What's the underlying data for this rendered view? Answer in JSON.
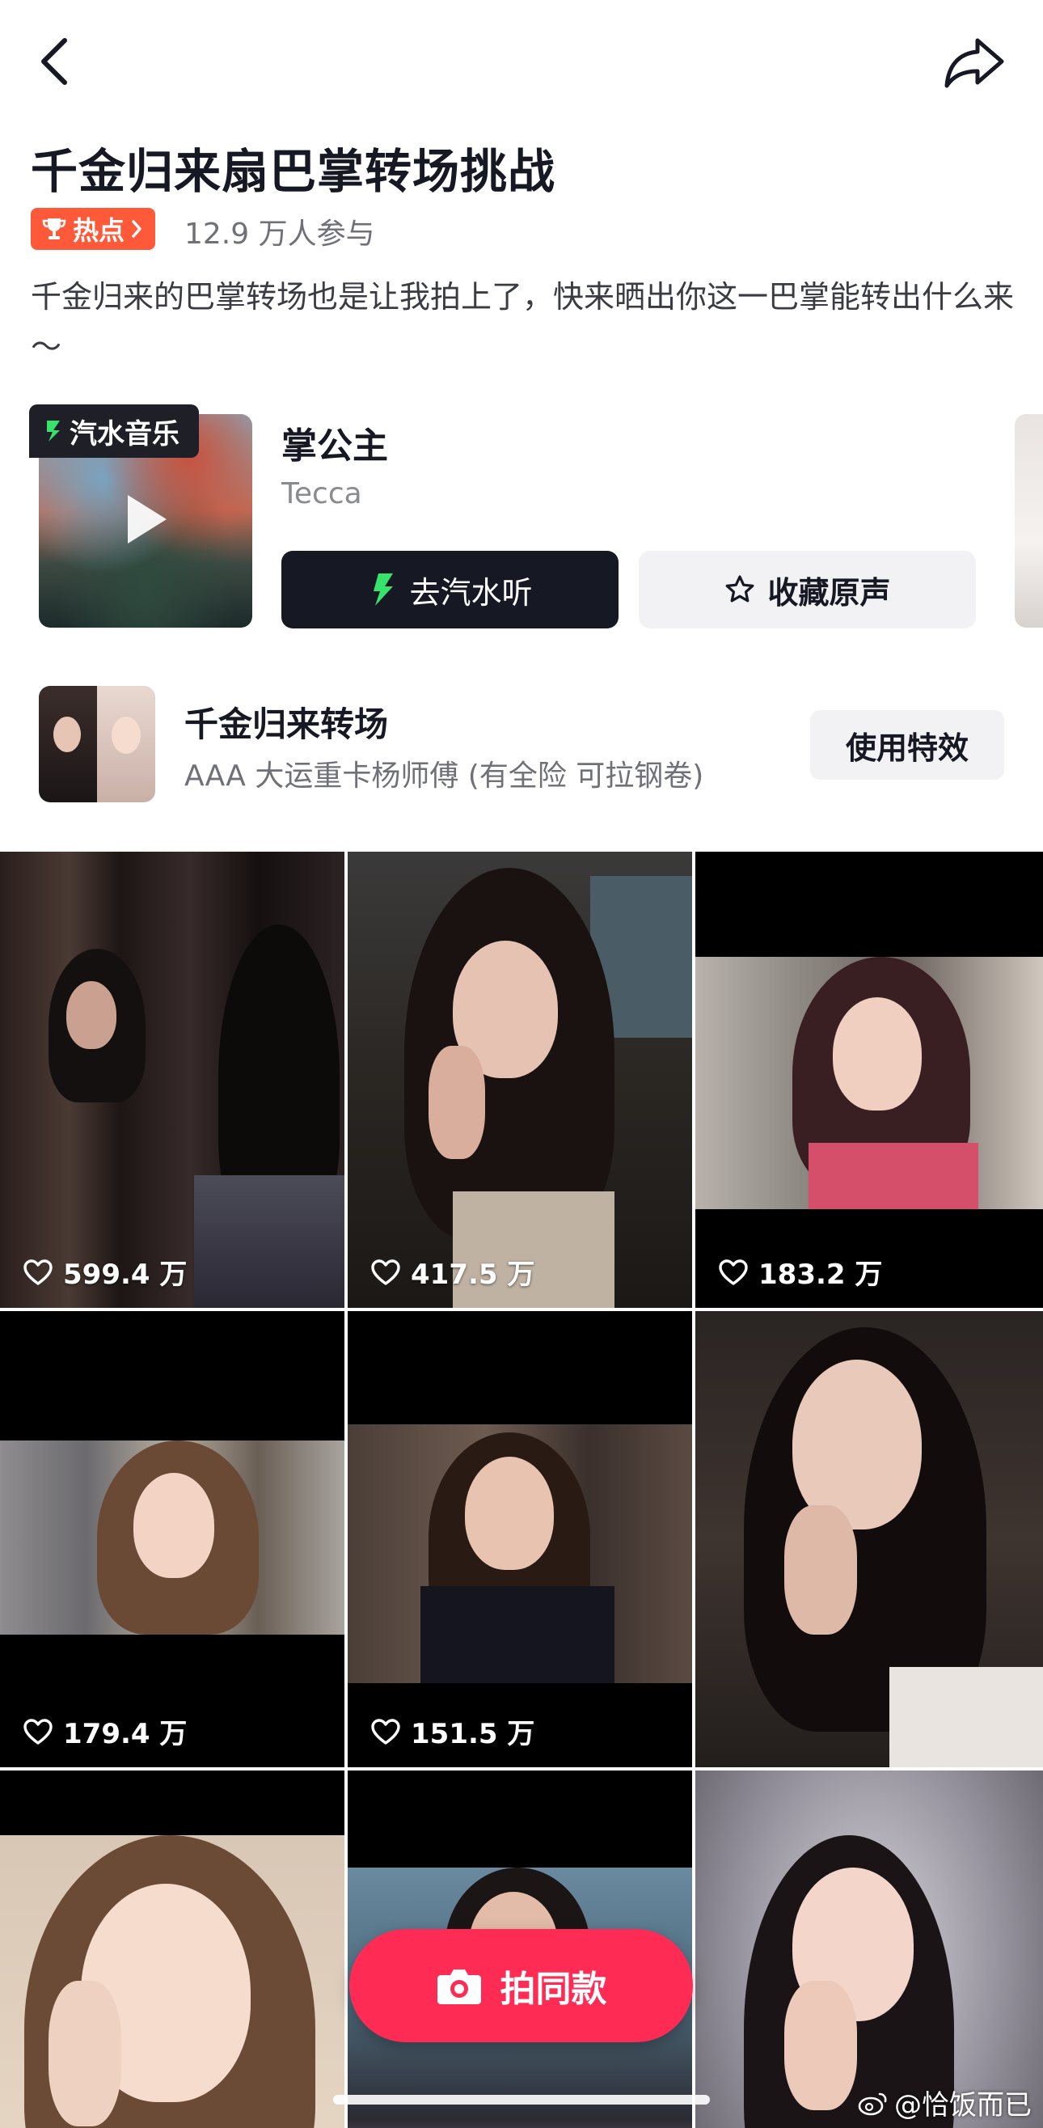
{
  "header": {
    "back_icon": "chevron-left-icon",
    "share_icon": "share-arrow-icon"
  },
  "challenge": {
    "title": "千金归来扇巴掌转场挑战",
    "hot_badge": "热点",
    "participants": "12.9 万人参与",
    "description": "千金归来的巴掌转场也是让我拍上了，快来晒出你这一巴掌能转出什么来～"
  },
  "music": {
    "tag": "汽水音乐",
    "title": "掌公主",
    "artist": "Tecca",
    "listen_label": "去汽水听",
    "collect_label": "收藏原声"
  },
  "effect": {
    "title": "千金归来转场",
    "subtitle": "AAA 大运重卡杨师傅 (有全险 可拉钢卷)",
    "use_label": "使用特效"
  },
  "videos": [
    {
      "likes": "599.4 万"
    },
    {
      "likes": "417.5 万"
    },
    {
      "likes": "183.2 万"
    },
    {
      "likes": "179.4 万"
    },
    {
      "likes": "151.5 万"
    },
    {
      "likes": ""
    },
    {
      "likes": ""
    },
    {
      "likes": ""
    },
    {
      "likes": ""
    }
  ],
  "shoot_button": {
    "label": "拍同款"
  },
  "watermark": "@恰饭而已",
  "colors": {
    "accent": "#fe2c55",
    "hot_badge": "#fe5a3a",
    "dark_button": "#161823"
  }
}
